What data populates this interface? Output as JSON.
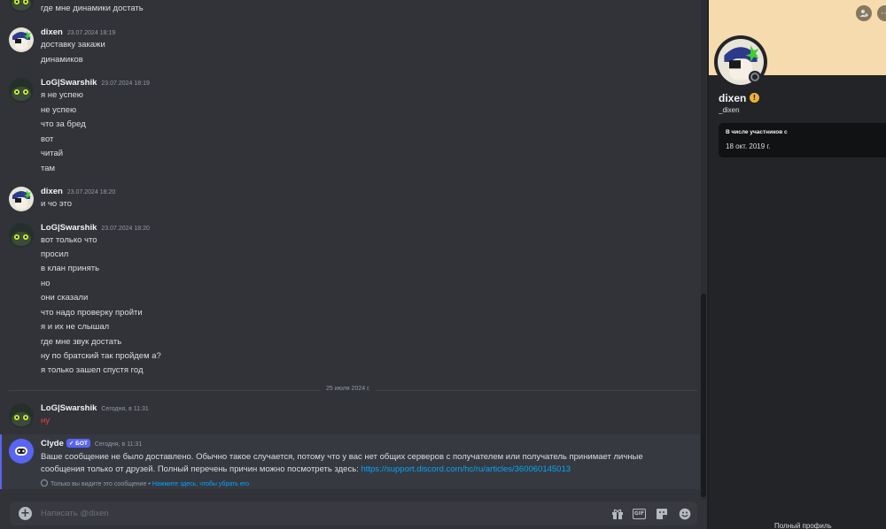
{
  "chat": {
    "messages": [
      {
        "author": "",
        "time": "",
        "lines": [
          "где мне динамики достать"
        ]
      },
      {
        "author": "dixen",
        "time": "23.07.2024 18:19",
        "lines": [
          "доставку закажи",
          "динамиков"
        ]
      },
      {
        "author": "LoG|Swarshik",
        "time": "23.07.2024 18:19",
        "lines": [
          "я не успею",
          "не успею",
          "что за бред",
          "вот",
          "читай",
          "там"
        ]
      },
      {
        "author": "dixen",
        "time": "23.07.2024 18:20",
        "lines": [
          "и чо это"
        ]
      },
      {
        "author": "LoG|Swarshik",
        "time": "23.07.2024 18:20",
        "lines": [
          "вот только что",
          "просил",
          "в клан принять",
          "но",
          "они сказали",
          "что надо проверку пройти",
          "я и их не слышал",
          "где мне звук достать",
          "ну по братский так пройдем а?",
          "я только зашел спустя год"
        ]
      },
      {
        "author": "LoG|Swarshik",
        "time": "Сегодня, в 11:31",
        "lines": [
          "ну"
        ]
      }
    ],
    "date_divider": "25 июля 2024 г.",
    "clyde": {
      "author": "Clyde",
      "badge": "БОТ",
      "time": "Сегодня, в 11:31",
      "text": "Ваше сообщение не было доставлено. Обычно такое случается, потому что у вас нет общих серверов с получателем или получатель принимает личные сообщения только от друзей. Полный перечень причин можно посмотреть здесь: ",
      "link": "https://support.discord.com/hc/ru/articles/360060145013",
      "ephemeral": "Только вы видите это сообщение • ",
      "dismiss": "Нажмите здесь, чтобы убрать его"
    },
    "input": {
      "placeholder": "Написать @dixen"
    },
    "toolbar": {
      "gif_label": "GIF"
    }
  },
  "profile": {
    "display_name": "dixen",
    "username": "_dixen",
    "member_since_label": "В числе участников с",
    "member_since_value": "18 окт. 2019 г.",
    "full_profile": "Полный профиль"
  },
  "colors": {
    "accent": "#5865f2",
    "link": "#00a8fc",
    "error_text": "#f23f43",
    "banner": "#f5dbad",
    "nitro_badge": "#f0b232"
  }
}
